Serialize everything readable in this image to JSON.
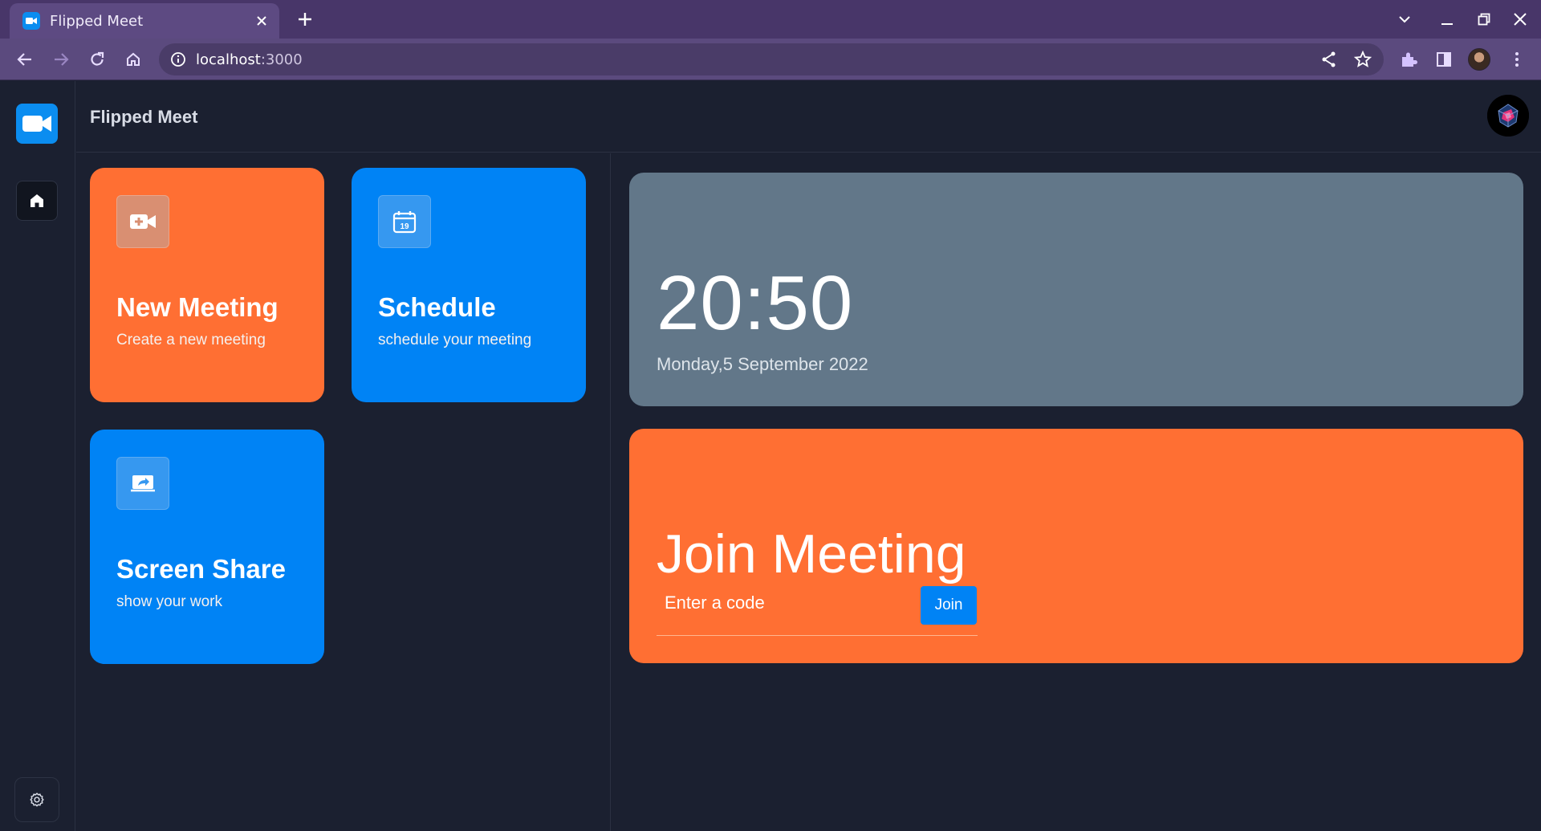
{
  "browser": {
    "tab_title": "Flipped Meet",
    "url_host": "localhost",
    "url_port": ":3000"
  },
  "app": {
    "title": "Flipped Meet"
  },
  "cards": {
    "new_meeting": {
      "title": "New Meeting",
      "subtitle": "Create a new meeting",
      "icon": "video-plus-icon",
      "color": "#ff6f33"
    },
    "schedule": {
      "title": "Schedule",
      "subtitle": "schedule your meeting",
      "icon": "calendar-icon",
      "icon_text": "19",
      "color": "#0083f5"
    },
    "screen_share": {
      "title": "Screen Share",
      "subtitle": "show your work",
      "icon": "screen-share-icon",
      "color": "#0083f5"
    }
  },
  "clock": {
    "time": "20:50",
    "date": "Monday,5 September 2022",
    "color": "#627789"
  },
  "join": {
    "title": "Join Meeting",
    "placeholder": "Enter a code",
    "button_label": "Join",
    "color": "#ff6f33"
  }
}
